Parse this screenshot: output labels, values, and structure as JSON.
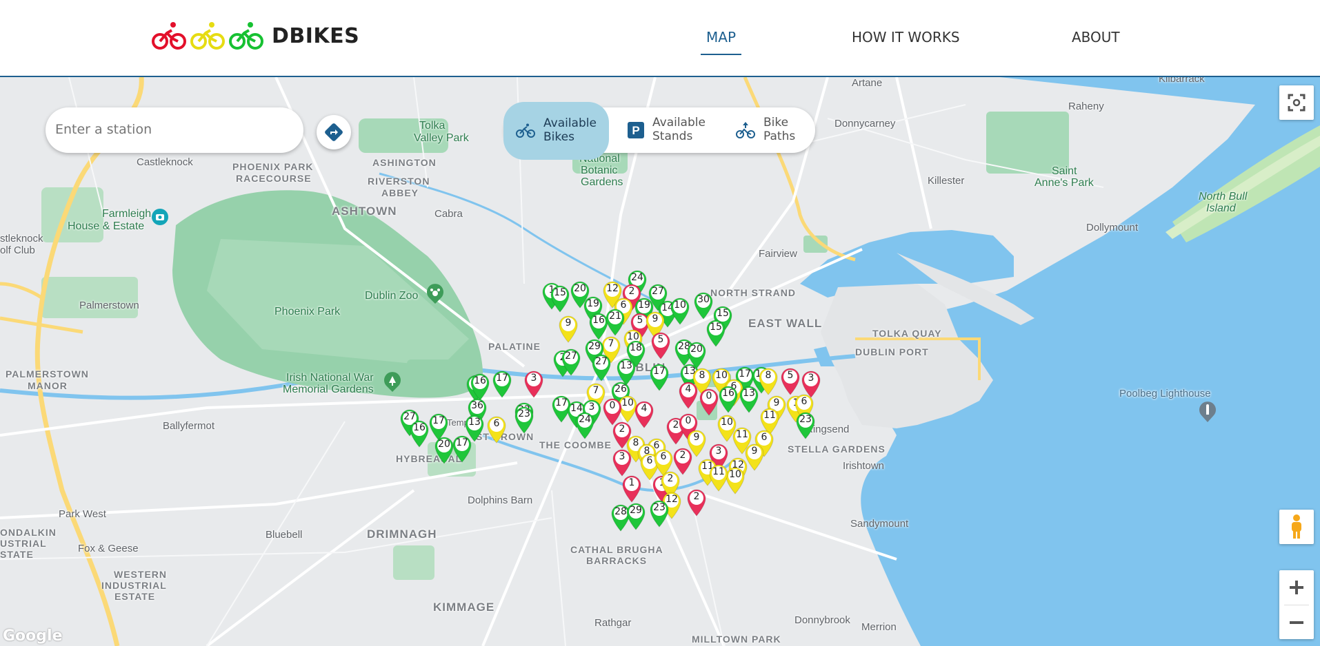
{
  "brand": "DBIKES",
  "nav": [
    {
      "label": "MAP"
    },
    {
      "label": "HOW IT WORKS"
    },
    {
      "label": "ABOUT"
    }
  ],
  "search": {
    "placeholder": "Enter a station"
  },
  "filters": [
    {
      "label": "Available\nBikes",
      "line1": "Available",
      "line2": "Bikes",
      "selected": true
    },
    {
      "label": "Available\nStands",
      "line1": "Available",
      "line2": "Stands",
      "selected": false
    },
    {
      "label": "Bike\nPaths",
      "line1": "Bike",
      "line2": "Paths",
      "selected": false
    }
  ],
  "colors": {
    "accent": "#1d5f8f",
    "selected_filter": "#a6d3e4",
    "pin_red": "#e8305a",
    "pin_yellow": "#f3e21a",
    "pin_green": "#1fc63a",
    "water": "#80c4ee",
    "park": "#96d1ab"
  },
  "map_labels": [
    {
      "text": "Tolka"
    },
    {
      "text": "Valley Park"
    },
    {
      "text": "Castleknock"
    },
    {
      "text": "PHOENIX PARK"
    },
    {
      "text": "RACECOURSE"
    },
    {
      "text": "ASHINGTON"
    },
    {
      "text": "RIVERSTON"
    },
    {
      "text": "ABBEY"
    },
    {
      "text": "ASHTOWN"
    },
    {
      "text": "Cabra"
    },
    {
      "text": "Farmleigh"
    },
    {
      "text": "House & Estate"
    },
    {
      "text": "stleknock"
    },
    {
      "text": "olf Club"
    },
    {
      "text": "Phoenix Park"
    },
    {
      "text": "Dublin Zoo"
    },
    {
      "text": "Palmerstown"
    },
    {
      "text": "PALMERSTOWN"
    },
    {
      "text": "MANOR"
    },
    {
      "text": "Irish National War"
    },
    {
      "text": "Memorial Gardens"
    },
    {
      "text": "Ballyfermot"
    },
    {
      "text": "HYBREASAL"
    },
    {
      "text": "Park West"
    },
    {
      "text": "ONDALKIN"
    },
    {
      "text": "USTRIAL"
    },
    {
      "text": "STATE"
    },
    {
      "text": "Bluebell"
    },
    {
      "text": "Fox & Geese"
    },
    {
      "text": "WESTERN"
    },
    {
      "text": "INDUSTRIAL"
    },
    {
      "text": "ESTATE"
    },
    {
      "text": "DRIMNAGH"
    },
    {
      "text": "KIMMAGE"
    },
    {
      "text": "CATHAL BRUGHA"
    },
    {
      "text": "BARRACKS"
    },
    {
      "text": "Rathgar"
    },
    {
      "text": "MILLTOWN PARK"
    },
    {
      "text": "Dolphins Barn"
    },
    {
      "text": "THE COOMBE"
    },
    {
      "text": "National"
    },
    {
      "text": "Botanic"
    },
    {
      "text": "Gardens"
    },
    {
      "text": "NORTH STRAND"
    },
    {
      "text": "EAST WALL"
    },
    {
      "text": "TOLKA QUAY"
    },
    {
      "text": "DUBLIN PORT"
    },
    {
      "text": "Fairview"
    },
    {
      "text": "STELLA GARDENS"
    },
    {
      "text": "Irishtown"
    },
    {
      "text": "Ringsend"
    },
    {
      "text": "Sandymount"
    },
    {
      "text": "Donnybrook"
    },
    {
      "text": "Merrion"
    },
    {
      "text": "Artane"
    },
    {
      "text": "Raheny"
    },
    {
      "text": "Donnycarney"
    },
    {
      "text": "Killester"
    },
    {
      "text": "Saint"
    },
    {
      "text": "Anne's Park"
    },
    {
      "text": "North Bull"
    },
    {
      "text": "Island"
    },
    {
      "text": "Dollymount"
    },
    {
      "text": "Kilbarrack"
    },
    {
      "text": "Poolbeg Lighthouse"
    },
    {
      "text": "PALATINE"
    },
    {
      "text": "DUBLIN"
    },
    {
      "text": "ST BROWN"
    },
    {
      "text": "Temp"
    }
  ],
  "stations": [
    {
      "n": "1",
      "c": "g"
    },
    {
      "n": "15",
      "c": "g"
    },
    {
      "n": "20",
      "c": "g"
    },
    {
      "n": "12",
      "c": "y"
    },
    {
      "n": "24",
      "c": "g"
    },
    {
      "n": "2",
      "c": "r"
    },
    {
      "n": "27",
      "c": "g"
    },
    {
      "n": "30",
      "c": "g"
    },
    {
      "n": "19",
      "c": "g"
    },
    {
      "n": "6",
      "c": "y"
    },
    {
      "n": "19",
      "c": "g"
    },
    {
      "n": "14",
      "c": "g"
    },
    {
      "n": "10",
      "c": "g"
    },
    {
      "n": "9",
      "c": "y"
    },
    {
      "n": "16",
      "c": "g"
    },
    {
      "n": "21",
      "c": "g"
    },
    {
      "n": "5",
      "c": "r"
    },
    {
      "n": "9",
      "c": "y"
    },
    {
      "n": "15",
      "c": "g"
    },
    {
      "n": "10",
      "c": "y"
    },
    {
      "n": "15",
      "c": "g"
    },
    {
      "n": "5",
      "c": "r"
    },
    {
      "n": "7",
      "c": "y"
    },
    {
      "n": "18",
      "c": "g"
    },
    {
      "n": "28",
      "c": "g"
    },
    {
      "n": "20",
      "c": "g"
    },
    {
      "n": "29",
      "c": "g"
    },
    {
      "n": "2",
      "c": "g"
    },
    {
      "n": "27",
      "c": "g"
    },
    {
      "n": "27",
      "c": "g"
    },
    {
      "n": "13",
      "c": "g"
    },
    {
      "n": "17",
      "c": "g"
    },
    {
      "n": "13",
      "c": "g"
    },
    {
      "n": "8",
      "c": "y"
    },
    {
      "n": "10",
      "c": "y"
    },
    {
      "n": "17",
      "c": "g"
    },
    {
      "n": "6",
      "c": "y"
    },
    {
      "n": "14",
      "c": "g"
    },
    {
      "n": "8",
      "c": "y"
    },
    {
      "n": "5",
      "c": "r"
    },
    {
      "n": "3",
      "c": "r"
    },
    {
      "n": "3",
      "c": "r"
    },
    {
      "n": "7",
      "c": "y"
    },
    {
      "n": "26",
      "c": "g"
    },
    {
      "n": "4",
      "c": "r"
    },
    {
      "n": "16",
      "c": "g"
    },
    {
      "n": "13",
      "c": "g"
    },
    {
      "n": "0",
      "c": "r"
    },
    {
      "n": "9",
      "c": "y"
    },
    {
      "n": "1",
      "c": "y"
    },
    {
      "n": "6",
      "c": "y"
    },
    {
      "n": "11",
      "c": "y"
    },
    {
      "n": "23",
      "c": "g"
    },
    {
      "n": "1",
      "c": "g"
    },
    {
      "n": "16",
      "c": "g"
    },
    {
      "n": "17",
      "c": "g"
    },
    {
      "n": "36",
      "c": "g"
    },
    {
      "n": "22",
      "c": "g"
    },
    {
      "n": "23",
      "c": "g"
    },
    {
      "n": "17",
      "c": "g"
    },
    {
      "n": "14",
      "c": "g"
    },
    {
      "n": "3",
      "c": "g"
    },
    {
      "n": "24",
      "c": "g"
    },
    {
      "n": "10",
      "c": "y"
    },
    {
      "n": "0",
      "c": "r"
    },
    {
      "n": "4",
      "c": "r"
    },
    {
      "n": "27",
      "c": "g"
    },
    {
      "n": "16",
      "c": "g"
    },
    {
      "n": "17",
      "c": "g"
    },
    {
      "n": "13",
      "c": "g"
    },
    {
      "n": "6",
      "c": "y"
    },
    {
      "n": "20",
      "c": "g"
    },
    {
      "n": "17",
      "c": "g"
    },
    {
      "n": "2",
      "c": "r"
    },
    {
      "n": "2",
      "c": "r"
    },
    {
      "n": "0",
      "c": "r"
    },
    {
      "n": "10",
      "c": "y"
    },
    {
      "n": "8",
      "c": "y"
    },
    {
      "n": "9",
      "c": "y"
    },
    {
      "n": "3",
      "c": "r"
    },
    {
      "n": "6",
      "c": "y"
    },
    {
      "n": "11",
      "c": "y"
    },
    {
      "n": "6",
      "c": "y"
    },
    {
      "n": "9",
      "c": "y"
    },
    {
      "n": "3",
      "c": "r"
    },
    {
      "n": "8",
      "c": "y"
    },
    {
      "n": "6",
      "c": "y"
    },
    {
      "n": "2",
      "c": "r"
    },
    {
      "n": "6",
      "c": "y"
    },
    {
      "n": "11",
      "c": "y"
    },
    {
      "n": "12",
      "c": "y"
    },
    {
      "n": "10",
      "c": "y"
    },
    {
      "n": "11",
      "c": "y"
    },
    {
      "n": "1",
      "c": "r"
    },
    {
      "n": "1",
      "c": "r"
    },
    {
      "n": "2",
      "c": "y"
    },
    {
      "n": "12",
      "c": "y"
    },
    {
      "n": "2",
      "c": "r"
    },
    {
      "n": "28",
      "c": "g"
    },
    {
      "n": "29",
      "c": "g"
    },
    {
      "n": "23",
      "c": "g"
    }
  ],
  "google_label": "Google"
}
